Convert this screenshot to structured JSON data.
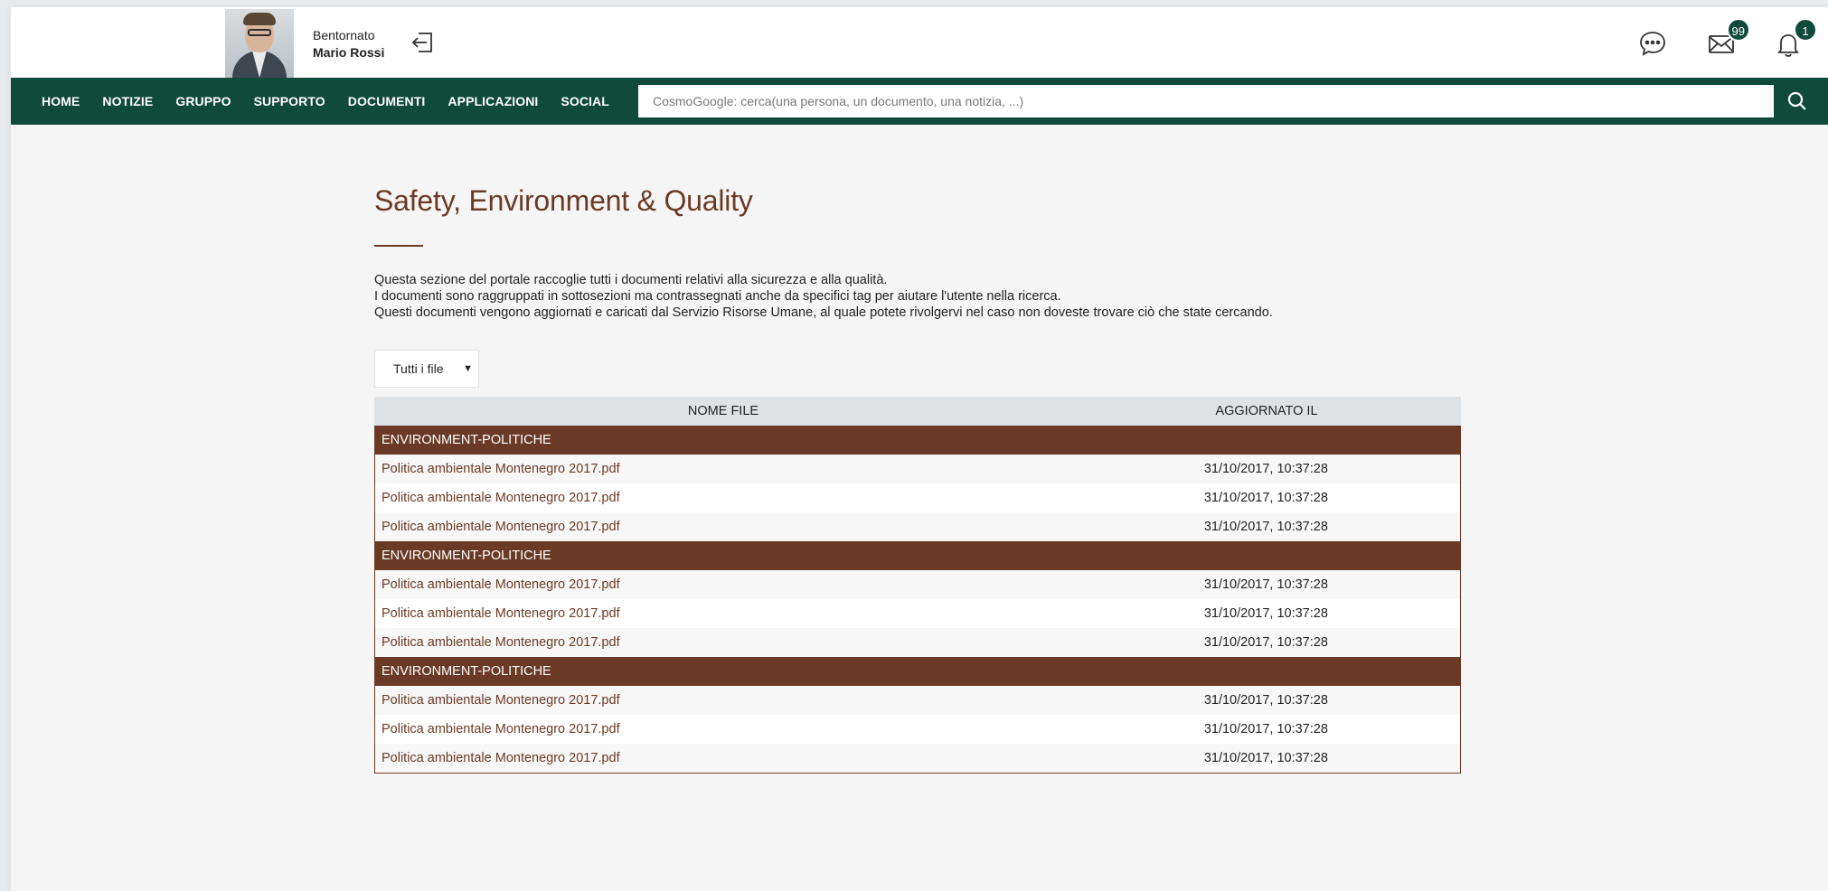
{
  "header": {
    "welcome_label": "Bentornato",
    "user_name": "Mario Rossi",
    "mail_badge": "99",
    "notifications_badge": "1"
  },
  "nav": {
    "items": [
      "HOME",
      "NOTIZIE",
      "GRUPPO",
      "SUPPORTO",
      "DOCUMENTI",
      "APPLICAZIONI",
      "SOCIAL"
    ]
  },
  "search": {
    "placeholder": "CosmoGoogle: cerca(una persona, un documento, una notizia, ...)"
  },
  "page": {
    "title": "Safety, Environment & Quality",
    "intro": [
      "Questa sezione del portale raccoglie tutti i documenti relativi alla sicurezza e alla qualità.",
      "I documenti sono raggruppati in sottosezioni ma contrassegnati anche da specifici tag per aiutare l'utente nella ricerca.",
      "Questi documenti vengono aggiornati e caricati dal Servizio Risorse Umane, al quale potete rivolgervi nel caso non doveste trovare ciò che state cercando."
    ],
    "filter_selected": "Tutti i file"
  },
  "table": {
    "columns": [
      "NOME FILE",
      "AGGIORNATO IL"
    ],
    "groups": [
      {
        "name": "ENVIRONMENT-POLITICHE",
        "files": [
          {
            "name": "Politica ambientale Montenegro 2017.pdf",
            "updated": "31/10/2017, 10:37:28"
          },
          {
            "name": "Politica ambientale Montenegro 2017.pdf",
            "updated": "31/10/2017, 10:37:28"
          },
          {
            "name": "Politica ambientale Montenegro 2017.pdf",
            "updated": "31/10/2017, 10:37:28"
          }
        ]
      },
      {
        "name": "ENVIRONMENT-POLITICHE",
        "files": [
          {
            "name": "Politica ambientale Montenegro 2017.pdf",
            "updated": "31/10/2017, 10:37:28"
          },
          {
            "name": "Politica ambientale Montenegro 2017.pdf",
            "updated": "31/10/2017, 10:37:28"
          },
          {
            "name": "Politica ambientale Montenegro 2017.pdf",
            "updated": "31/10/2017, 10:37:28"
          }
        ]
      },
      {
        "name": "ENVIRONMENT-POLITICHE",
        "files": [
          {
            "name": "Politica ambientale Montenegro 2017.pdf",
            "updated": "31/10/2017, 10:37:28"
          },
          {
            "name": "Politica ambientale Montenegro 2017.pdf",
            "updated": "31/10/2017, 10:37:28"
          },
          {
            "name": "Politica ambientale Montenegro 2017.pdf",
            "updated": "31/10/2017, 10:37:28"
          }
        ]
      }
    ]
  },
  "icons": {
    "logout": "logout-icon",
    "chat": "chat-icon",
    "mail": "mail-icon",
    "notifications": "bell-icon",
    "search": "search-icon",
    "filter_caret": "caret-down-icon"
  },
  "colors": {
    "brand_green": "#0f4a3b",
    "accent_brown": "#6b3a26"
  }
}
